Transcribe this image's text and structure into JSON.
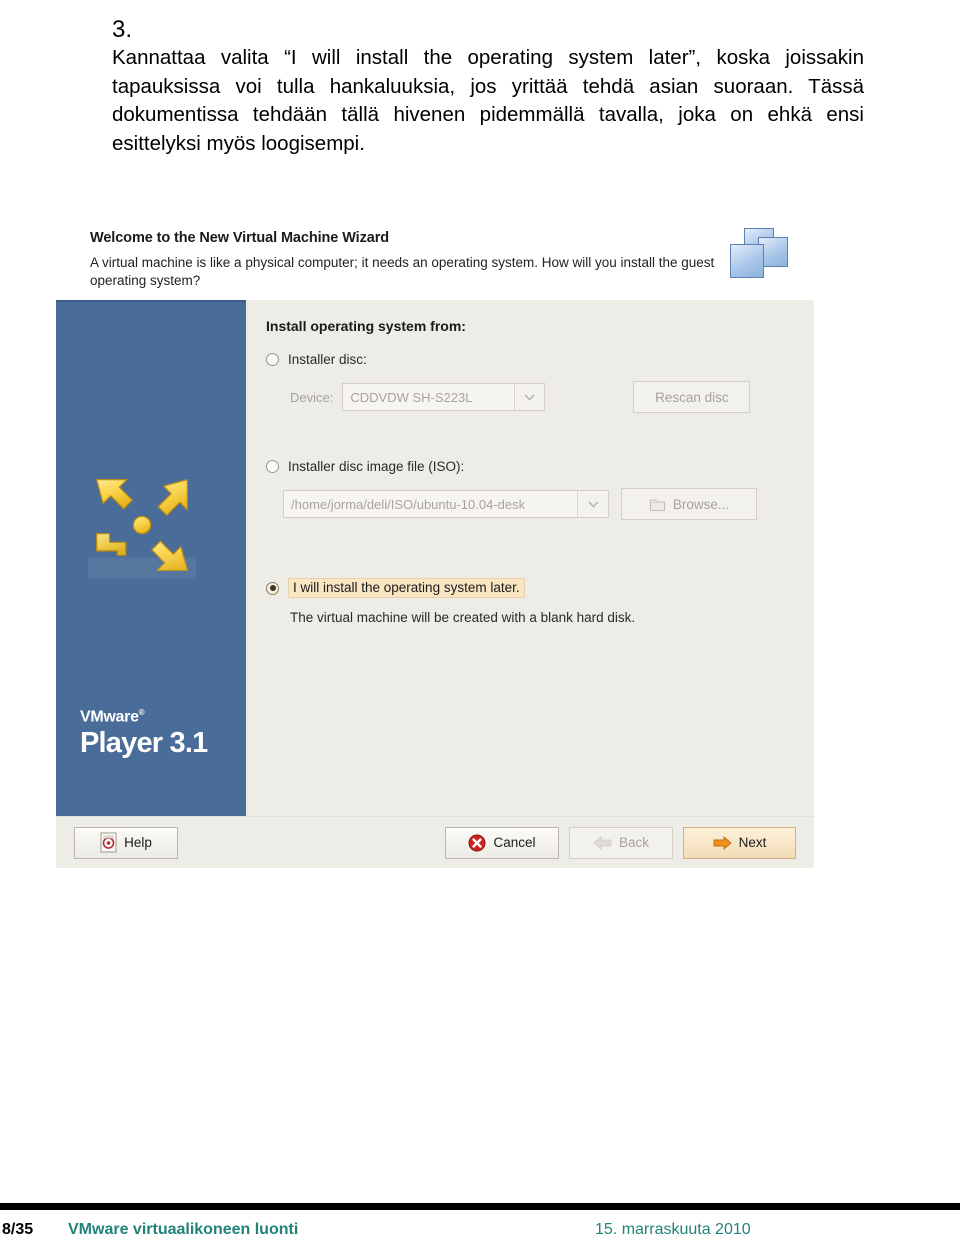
{
  "slide": {
    "number": "3.",
    "paragraph": "Kannattaa valita “I will install the operating system later”, koska joissakin tapauksissa voi tulla hankaluuksia, jos yrittää tehdä asian suoraan. Tässä dokumentissa tehdään tällä hivenen pidemmällä tavalla, joka on ehkä ensi esittelyksi myös loogisempi."
  },
  "wizard": {
    "header": {
      "title": "Welcome to the New Virtual Machine Wizard",
      "subtitle": "A virtual machine is like a physical computer; it needs an operating system. How will you install the guest operating system?",
      "icon": "stacked-squares-icon"
    },
    "sidebar": {
      "logo": "vmware-arrows-logo",
      "brand_top": "VMware",
      "brand_trademark": "®",
      "brand_main": "Player 3.1",
      "background_color": "#4a6c99"
    },
    "main": {
      "section_title": "Install operating system from:",
      "options": [
        {
          "id": "installer-disc",
          "label": "Installer disc:",
          "underline_char": "d",
          "selected": false,
          "enabled": false
        },
        {
          "id": "iso-image",
          "label": "Installer disc image file (ISO):",
          "underline_char": "a",
          "selected": false,
          "enabled": false
        },
        {
          "id": "install-later",
          "label": "I will install the operating system later.",
          "underline_char": "w",
          "selected": true,
          "enabled": true,
          "highlight_color": "#fbe6c4"
        }
      ],
      "device_row": {
        "label": "Device:",
        "value": "CDDVDW SH-S223L",
        "dropdown_icon": "chevron-down-icon",
        "button_label": "Rescan disc",
        "button_underline": "e",
        "enabled": false
      },
      "iso_row": {
        "value": "/home/jorma/deli/ISO/ubuntu-10.04-desk",
        "dropdown_icon": "chevron-down-icon",
        "button_label": "Browse...",
        "button_underline": "r",
        "button_icon": "folder-icon",
        "enabled": false
      },
      "description": "The virtual machine will be created with a blank hard disk."
    },
    "footer": {
      "help": {
        "label": "Help",
        "underline": "H",
        "icon": "help-document-icon",
        "enabled": true
      },
      "cancel": {
        "label": "Cancel",
        "underline": "C",
        "icon": "error-circle-icon",
        "enabled": true
      },
      "back": {
        "label": "Back",
        "underline": "B",
        "icon": "back-arrow-icon",
        "enabled": false
      },
      "next": {
        "label": "Next",
        "underline": "N",
        "icon": "next-arrow-icon",
        "enabled": true,
        "primary": true
      }
    }
  },
  "page_footer": {
    "page": "8/35",
    "title": "VMware virtuaalikoneen luonti",
    "date": "15. marraskuuta 2010",
    "accent_color": "#218377"
  }
}
